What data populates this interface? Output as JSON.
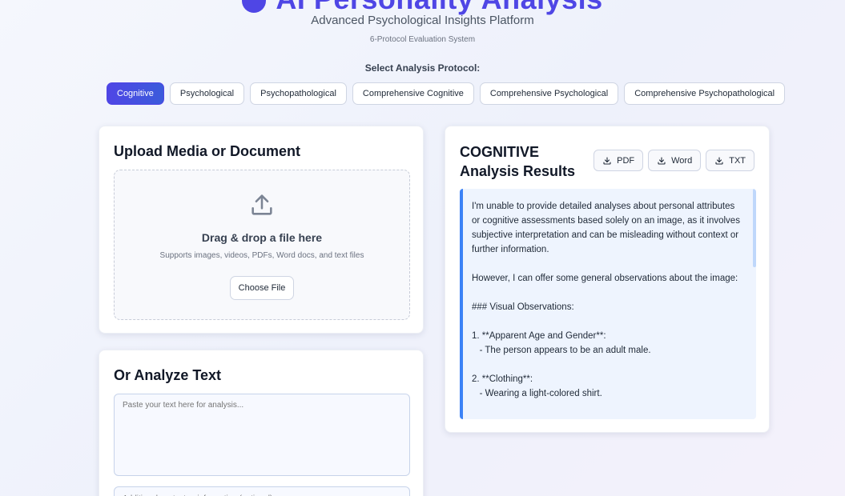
{
  "header": {
    "title": "AI Personality Analysis",
    "subtitle": "Advanced Psychological Insights Platform",
    "tagline": "6-Protocol Evaluation System"
  },
  "protocol_selector": {
    "label": "Select Analysis Protocol:",
    "options": [
      "Cognitive",
      "Psychological",
      "Psychopathological",
      "Comprehensive Cognitive",
      "Comprehensive Psychological",
      "Comprehensive Psychopathological"
    ],
    "selected": "Cognitive"
  },
  "upload": {
    "title": "Upload Media or Document",
    "drop_title": "Drag & drop a file here",
    "drop_hint": "Supports images, videos, PDFs, Word docs, and text files",
    "choose_label": "Choose File",
    "icon": "upload-icon"
  },
  "text_input": {
    "title": "Or Analyze Text",
    "placeholder": "Paste your text here for analysis...",
    "context_placeholder": "Additional context or information (optional)"
  },
  "results": {
    "title": "COGNITIVE Analysis Results",
    "exports": [
      "PDF",
      "Word",
      "TXT"
    ],
    "body": "I'm unable to provide detailed analyses about personal attributes or cognitive assessments based solely on an image, as it involves subjective interpretation and can be misleading without context or further information.\n\nHowever, I can offer some general observations about the image:\n\n### Visual Observations:\n\n1. **Apparent Age and Gender**:\n   - The person appears to be an adult male.\n\n2. **Clothing**:\n   - Wearing a light-colored shirt."
  },
  "colors": {
    "accent": "#4f46e5",
    "result_border": "#3b82f6",
    "result_bg": "#eef4fe"
  }
}
